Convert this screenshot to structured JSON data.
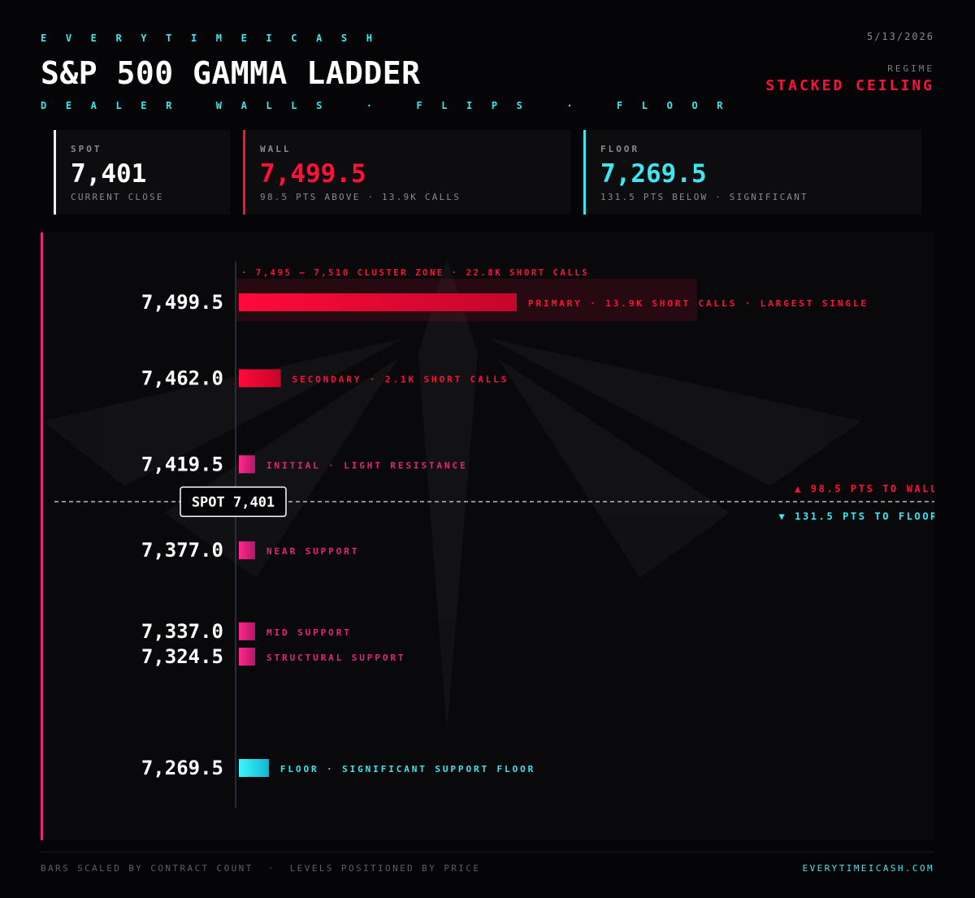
{
  "header": {
    "brand": "EVERYTIMEICASH",
    "date": "5/13/2026",
    "title": "S&P 500 GAMMA LADDER",
    "subtitle": "DEALER WALLS · FLIPS · FLOOR",
    "regime_label": "REGIME",
    "regime_value": "STACKED CEILING"
  },
  "cards": {
    "spot": {
      "label": "SPOT",
      "value": "7,401",
      "sub": "CURRENT CLOSE"
    },
    "wall": {
      "label": "WALL",
      "value": "7,499.5",
      "sub": "98.5 PTS ABOVE · 13.9K CALLS"
    },
    "floor": {
      "label": "FLOOR",
      "value": "7,269.5",
      "sub": "131.5 PTS BELOW · SIGNIFICANT"
    }
  },
  "colors": {
    "wall": "#ff1238",
    "magenta": "#e3267a",
    "cyan": "#3ee6f0",
    "spot": "#f0f0f0"
  },
  "chart_data": {
    "type": "bar",
    "orientation": "horizontal",
    "y_axis": "price level",
    "spot": {
      "value": 7401,
      "label": "SPOT 7,401"
    },
    "cluster_zone": {
      "from": 7495,
      "to": 7510,
      "label": "· 7,495 — 7,510 CLUSTER ZONE · 22.8K SHORT CALLS"
    },
    "distance_labels": {
      "above": "▲ 98.5 PTS TO WALL",
      "below": "▼ 131.5 PTS TO FLOOR"
    },
    "levels": [
      {
        "price": 7499.5,
        "price_label": "7,499.5",
        "contracts": 13900,
        "kind": "wall",
        "annotation": "PRIMARY · 13.9K SHORT CALLS · LARGEST SINGLE"
      },
      {
        "price": 7462.0,
        "price_label": "7,462.0",
        "contracts": 2100,
        "kind": "wall",
        "annotation": "SECONDARY · 2.1K SHORT CALLS"
      },
      {
        "price": 7419.5,
        "price_label": "7,419.5",
        "contracts": 800,
        "kind": "flip",
        "annotation": "INITIAL · LIGHT RESISTANCE"
      },
      {
        "price": 7377.0,
        "price_label": "7,377.0",
        "contracts": 800,
        "kind": "flip",
        "annotation": "NEAR SUPPORT"
      },
      {
        "price": 7337.0,
        "price_label": "7,337.0",
        "contracts": 800,
        "kind": "flip",
        "annotation": "MID SUPPORT"
      },
      {
        "price": 7324.5,
        "price_label": "7,324.5",
        "contracts": 800,
        "kind": "flip",
        "annotation": "STRUCTURAL SUPPORT"
      },
      {
        "price": 7269.5,
        "price_label": "7,269.5",
        "contracts": 1500,
        "kind": "floor",
        "annotation": "FLOOR · SIGNIFICANT SUPPORT FLOOR"
      }
    ]
  },
  "footer": {
    "note": "BARS SCALED BY CONTRACT COUNT  ·  LEVELS POSITIONED BY PRICE",
    "site": "EVERYTIMEICASH.COM"
  }
}
